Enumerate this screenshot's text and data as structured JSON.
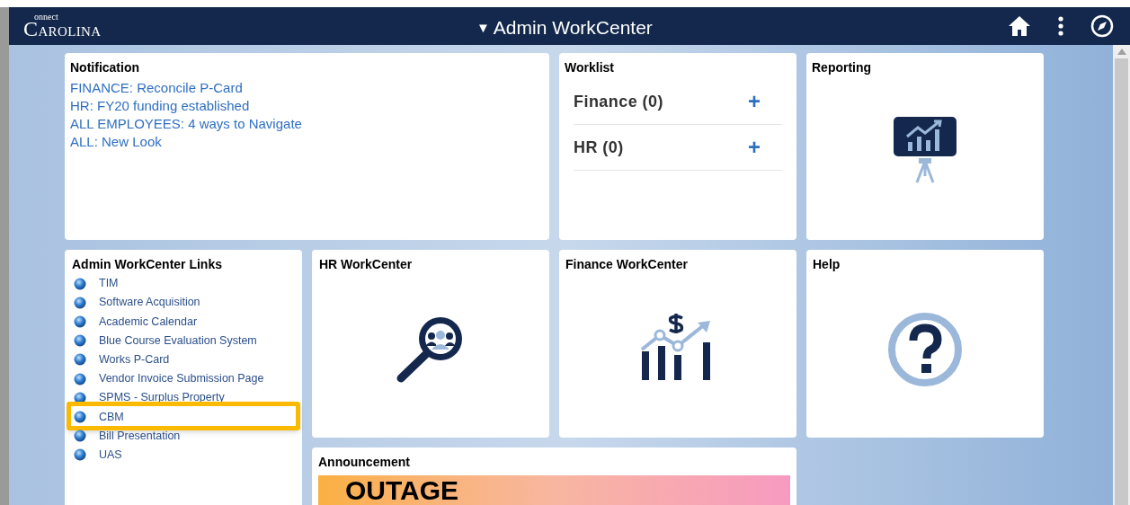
{
  "header": {
    "logo_small": "onnect",
    "logo_main": "CAROLINA",
    "title_caret": "▼",
    "title": "Admin WorkCenter"
  },
  "notification": {
    "title": "Notification",
    "links": [
      "FINANCE: Reconcile P-Card",
      "HR: FY20 funding established",
      "ALL EMPLOYEES: 4 ways to Navigate",
      "ALL: New Look"
    ]
  },
  "worklist": {
    "title": "Worklist",
    "items": [
      {
        "label": "Finance (0)",
        "action": "+"
      },
      {
        "label": "HR (0)",
        "action": "+"
      }
    ]
  },
  "reporting": {
    "title": "Reporting"
  },
  "links_tile": {
    "title": "Admin WorkCenter Links",
    "items": [
      {
        "label": "TIM",
        "highlighted": false
      },
      {
        "label": "Software Acquisition",
        "highlighted": false
      },
      {
        "label": "Academic Calendar",
        "highlighted": false
      },
      {
        "label": "Blue Course Evaluation System",
        "highlighted": false
      },
      {
        "label": "Works P-Card",
        "highlighted": false
      },
      {
        "label": "Vendor Invoice Submission Page",
        "highlighted": false
      },
      {
        "label": "SPMS - Surplus Property",
        "highlighted": false
      },
      {
        "label": "CBM",
        "highlighted": true
      },
      {
        "label": "Bill Presentation",
        "highlighted": false
      },
      {
        "label": "UAS",
        "highlighted": false
      }
    ]
  },
  "hr_workcenter": {
    "title": "HR WorkCenter"
  },
  "finance_workcenter": {
    "title": "Finance WorkCenter"
  },
  "help": {
    "title": "Help"
  },
  "announcement": {
    "title": "Announcement",
    "banner_text": "OUTAGE"
  }
}
